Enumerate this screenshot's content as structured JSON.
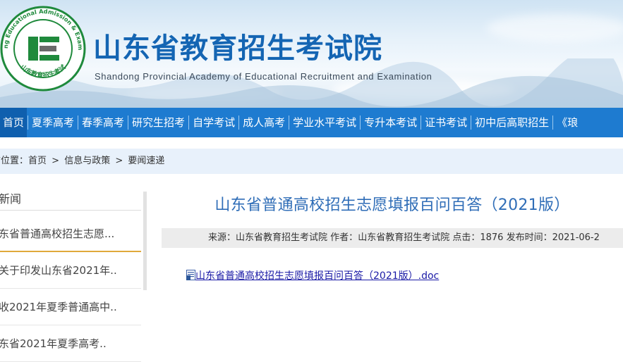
{
  "header": {
    "title": "山东省教育招生考试院",
    "subtitle": "Shandong Provincial Academy of Educational Recruitment and Examination",
    "logo": {
      "ring_text": "Shandong Educational Admission & Examination",
      "ring_text_cn": "山东教育招生考试",
      "letter": "E"
    }
  },
  "nav": {
    "items": [
      {
        "label": "首页",
        "active": true
      },
      {
        "label": "夏季高考"
      },
      {
        "label": "春季高考"
      },
      {
        "label": "研究生招考"
      },
      {
        "label": "自学考试"
      },
      {
        "label": "成人高考"
      },
      {
        "label": "学业水平考试"
      },
      {
        "label": "专升本考试"
      },
      {
        "label": "证书考试"
      },
      {
        "label": "初中后高职招生"
      },
      {
        "label": "《琅"
      }
    ]
  },
  "breadcrumb": {
    "prefix": "前位置：",
    "items": [
      "首页",
      "信息与政策",
      "要闻速递"
    ],
    "separator": ">"
  },
  "sidebar": {
    "title": "新闻",
    "items": [
      {
        "label": "东省普通高校招生志愿...",
        "active": true
      },
      {
        "label": "关于印发山东省2021年.."
      },
      {
        "label": "收2021年夏季普通高中.."
      },
      {
        "label": "东省2021年夏季高考.."
      }
    ]
  },
  "article": {
    "title": "山东省普通高校招生志愿填报百问百答（2021版）",
    "meta": {
      "source_label": "来源：",
      "source": "山东省教育招生考试院",
      "author_label": "作者：",
      "author": "山东省教育招生考试院",
      "clicks_label": "点击：",
      "clicks": "1876",
      "date_label": "发布时间：",
      "date": "2021-06-2"
    },
    "attachment": {
      "icon": "word-doc-icon",
      "label": "山东省普通高校招生志愿填报百问百答（2021版）.doc"
    }
  },
  "colors": {
    "brand_blue": "#1465b3",
    "nav_blue": "#1e7bd0",
    "nav_active": "#0f5fae",
    "logo_green": "#1f8a3c",
    "breadcrumb_bg": "#e8f1fb",
    "article_title": "#2f6db7",
    "active_underline": "#e0a93b"
  }
}
